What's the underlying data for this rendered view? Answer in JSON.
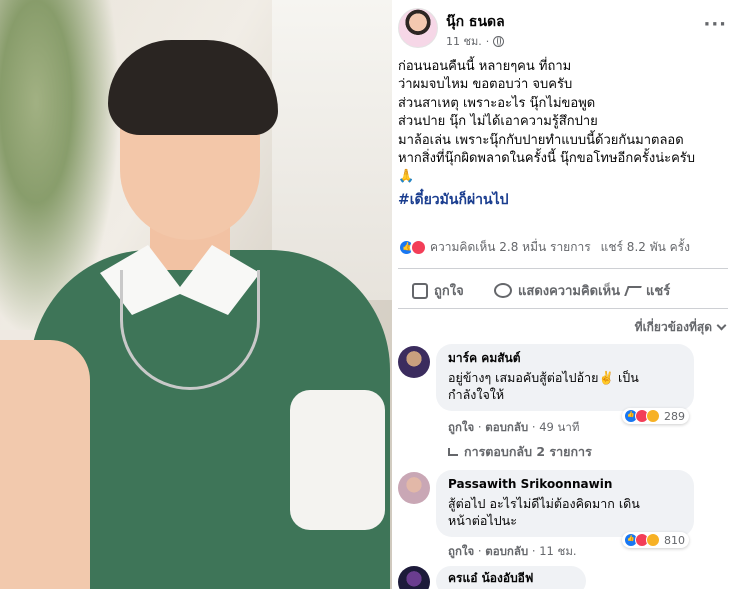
{
  "post": {
    "author": "นุ๊ก ธนดล",
    "time": "11 ชม.",
    "privacy_icon": "globe-icon",
    "menu_icon": "more-dots-icon",
    "lines": [
      "ก่อนนอนคืนนี้ หลายๆคน ที่ถาม",
      "ว่าผมจบไหม ขอตอบว่า จบครับ",
      "ส่วนสาเหตุ เพราะอะไร นุ๊กไม่ขอพูด",
      "ส่วนปาย นุ๊ก ไม่ได้เอาความรู้สึกปาย",
      "มาล้อเล่น เพราะนุ๊กกับปายทำแบบนี้ด้วยกันมาตลอด",
      "หากสิ่งที่นุ๊กผิดพลาดในครั้งนี้ นุ๊กขอโทษอีกครั้งน่ะครับ",
      "🙏"
    ],
    "hashtag": "#เดี๋ยวมันก็ผ่านไป"
  },
  "stats": {
    "comments": "ความคิดเห็น 2.8 หมื่น รายการ",
    "shares": "แชร์ 8.2 พัน ครั้ง"
  },
  "actions": {
    "like": "ถูกใจ",
    "comment": "แสดงความคิดเห็น",
    "share": "แชร์"
  },
  "sort_label": "ที่เกี่ยวข้องที่สุด",
  "comments": [
    {
      "name": "มาร์ค คมสันต์",
      "text_lines": [
        "อยู่ข้างๆ เสมอคับสู้ต่อไปอ้าย✌️ เป็น",
        "กำลังใจให้"
      ],
      "reactions": "289",
      "like": "ถูกใจ",
      "reply": "ตอบกลับ",
      "time": "49 นาที",
      "replies": "การตอบกลับ 2 รายการ"
    },
    {
      "name": "Passawith Srikoonnawin",
      "text_lines": [
        "สู้ต่อไป อะไรไม่ดีไม่ต้องคิดมาก เดิน",
        "หน้าต่อไปนะ"
      ],
      "reactions": "810",
      "like": "ถูกใจ",
      "reply": "ตอบกลับ",
      "time": "11 ชม."
    },
    {
      "name": "ครแอ๋ น้องอับอีฟ"
    }
  ],
  "colors": {
    "link_blue": "#1a3d8f",
    "like_blue": "#1877f2",
    "love_red": "#f33e58",
    "haha_yellow": "#f7b125",
    "muted": "#65676b",
    "bubble": "#f0f2f5",
    "shirt_green": "#3e7558"
  }
}
